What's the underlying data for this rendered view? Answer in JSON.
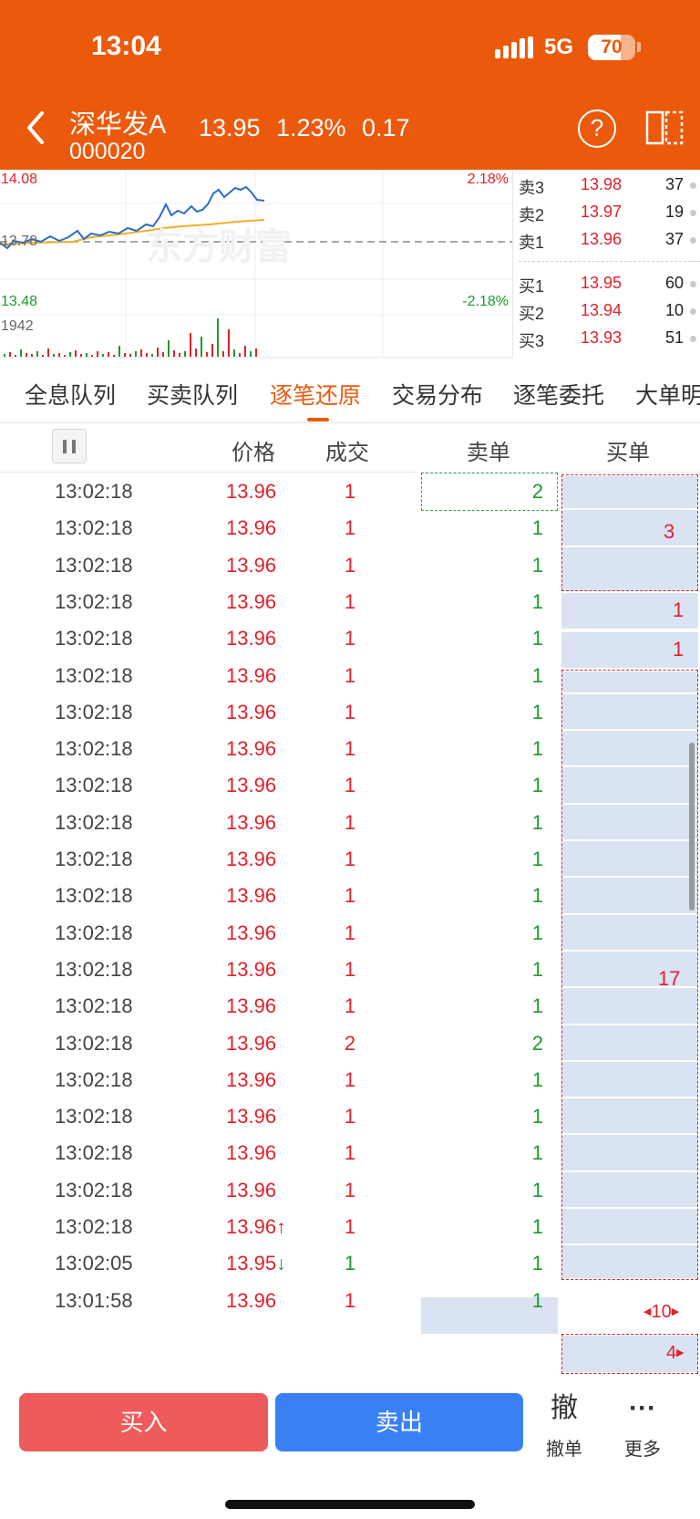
{
  "status": {
    "time": "13:04",
    "network": "5G",
    "battery": "70",
    "battery_level": 0.7
  },
  "header": {
    "name": "深华发A",
    "code": "000020",
    "price": "13.95",
    "change_pct": "1.23%",
    "change": "0.17",
    "help_label": "?"
  },
  "chart_labels": {
    "high": "14.08",
    "mid": "13.78",
    "low": "13.48",
    "high_pct": "2.18%",
    "low_pct": "-2.18%",
    "volume": "1942",
    "watermark": "东方财富"
  },
  "order_book": {
    "asks": [
      {
        "label": "卖3",
        "price": "13.98",
        "volume": "37"
      },
      {
        "label": "卖2",
        "price": "13.97",
        "volume": "19"
      },
      {
        "label": "卖1",
        "price": "13.96",
        "volume": "37"
      }
    ],
    "bids": [
      {
        "label": "买1",
        "price": "13.95",
        "volume": "60"
      },
      {
        "label": "买2",
        "price": "13.94",
        "volume": "10"
      },
      {
        "label": "买3",
        "price": "13.93",
        "volume": "51"
      }
    ]
  },
  "tabs": [
    "全息队列",
    "买卖队列",
    "逐笔还原",
    "交易分布",
    "逐笔委托",
    "大单明"
  ],
  "active_tab": "逐笔还原",
  "columns": {
    "price": "价格",
    "volume": "成交",
    "sell": "卖单",
    "buy": "买单"
  },
  "rows": [
    {
      "time": "13:02:18",
      "price": "13.96",
      "arrow": "",
      "deal": "1",
      "sell": "2"
    },
    {
      "time": "13:02:18",
      "price": "13.96",
      "arrow": "",
      "deal": "1",
      "sell": "1"
    },
    {
      "time": "13:02:18",
      "price": "13.96",
      "arrow": "",
      "deal": "1",
      "sell": "1"
    },
    {
      "time": "13:02:18",
      "price": "13.96",
      "arrow": "",
      "deal": "1",
      "sell": "1"
    },
    {
      "time": "13:02:18",
      "price": "13.96",
      "arrow": "",
      "deal": "1",
      "sell": "1"
    },
    {
      "time": "13:02:18",
      "price": "13.96",
      "arrow": "",
      "deal": "1",
      "sell": "1"
    },
    {
      "time": "13:02:18",
      "price": "13.96",
      "arrow": "",
      "deal": "1",
      "sell": "1"
    },
    {
      "time": "13:02:18",
      "price": "13.96",
      "arrow": "",
      "deal": "1",
      "sell": "1"
    },
    {
      "time": "13:02:18",
      "price": "13.96",
      "arrow": "",
      "deal": "1",
      "sell": "1"
    },
    {
      "time": "13:02:18",
      "price": "13.96",
      "arrow": "",
      "deal": "1",
      "sell": "1"
    },
    {
      "time": "13:02:18",
      "price": "13.96",
      "arrow": "",
      "deal": "1",
      "sell": "1"
    },
    {
      "time": "13:02:18",
      "price": "13.96",
      "arrow": "",
      "deal": "1",
      "sell": "1"
    },
    {
      "time": "13:02:18",
      "price": "13.96",
      "arrow": "",
      "deal": "1",
      "sell": "1"
    },
    {
      "time": "13:02:18",
      "price": "13.96",
      "arrow": "",
      "deal": "1",
      "sell": "1"
    },
    {
      "time": "13:02:18",
      "price": "13.96",
      "arrow": "",
      "deal": "1",
      "sell": "1"
    },
    {
      "time": "13:02:18",
      "price": "13.96",
      "arrow": "",
      "deal": "2",
      "sell": "2"
    },
    {
      "time": "13:02:18",
      "price": "13.96",
      "arrow": "",
      "deal": "1",
      "sell": "1"
    },
    {
      "time": "13:02:18",
      "price": "13.96",
      "arrow": "",
      "deal": "1",
      "sell": "1"
    },
    {
      "time": "13:02:18",
      "price": "13.96",
      "arrow": "",
      "deal": "1",
      "sell": "1"
    },
    {
      "time": "13:02:18",
      "price": "13.96",
      "arrow": "",
      "deal": "1",
      "sell": "1"
    },
    {
      "time": "13:02:18",
      "price": "13.96",
      "arrow": "↑",
      "deal": "1",
      "sell": "1"
    },
    {
      "time": "13:02:05",
      "price": "13.95",
      "arrow": "↓",
      "deal": "1",
      "sell": "1"
    },
    {
      "time": "13:01:58",
      "price": "13.96",
      "arrow": "",
      "deal": "1",
      "sell": "1"
    }
  ],
  "buy_orders": {
    "group1": "3",
    "single1": "1",
    "single2": "1",
    "group2": "17",
    "row22": "10",
    "row23": "4"
  },
  "bottom": {
    "buy": "买入",
    "sell": "卖出",
    "cancel_icon": "撤",
    "cancel": "撤单",
    "more_icon": "···",
    "more": "更多"
  },
  "colors": {
    "header": "#eb5a0c",
    "up": "#e0212a",
    "down": "#1d9a2c",
    "buy_button": "#ee5b5b",
    "sell_button": "#3a80f5",
    "highlight": "#d9e3f2"
  }
}
